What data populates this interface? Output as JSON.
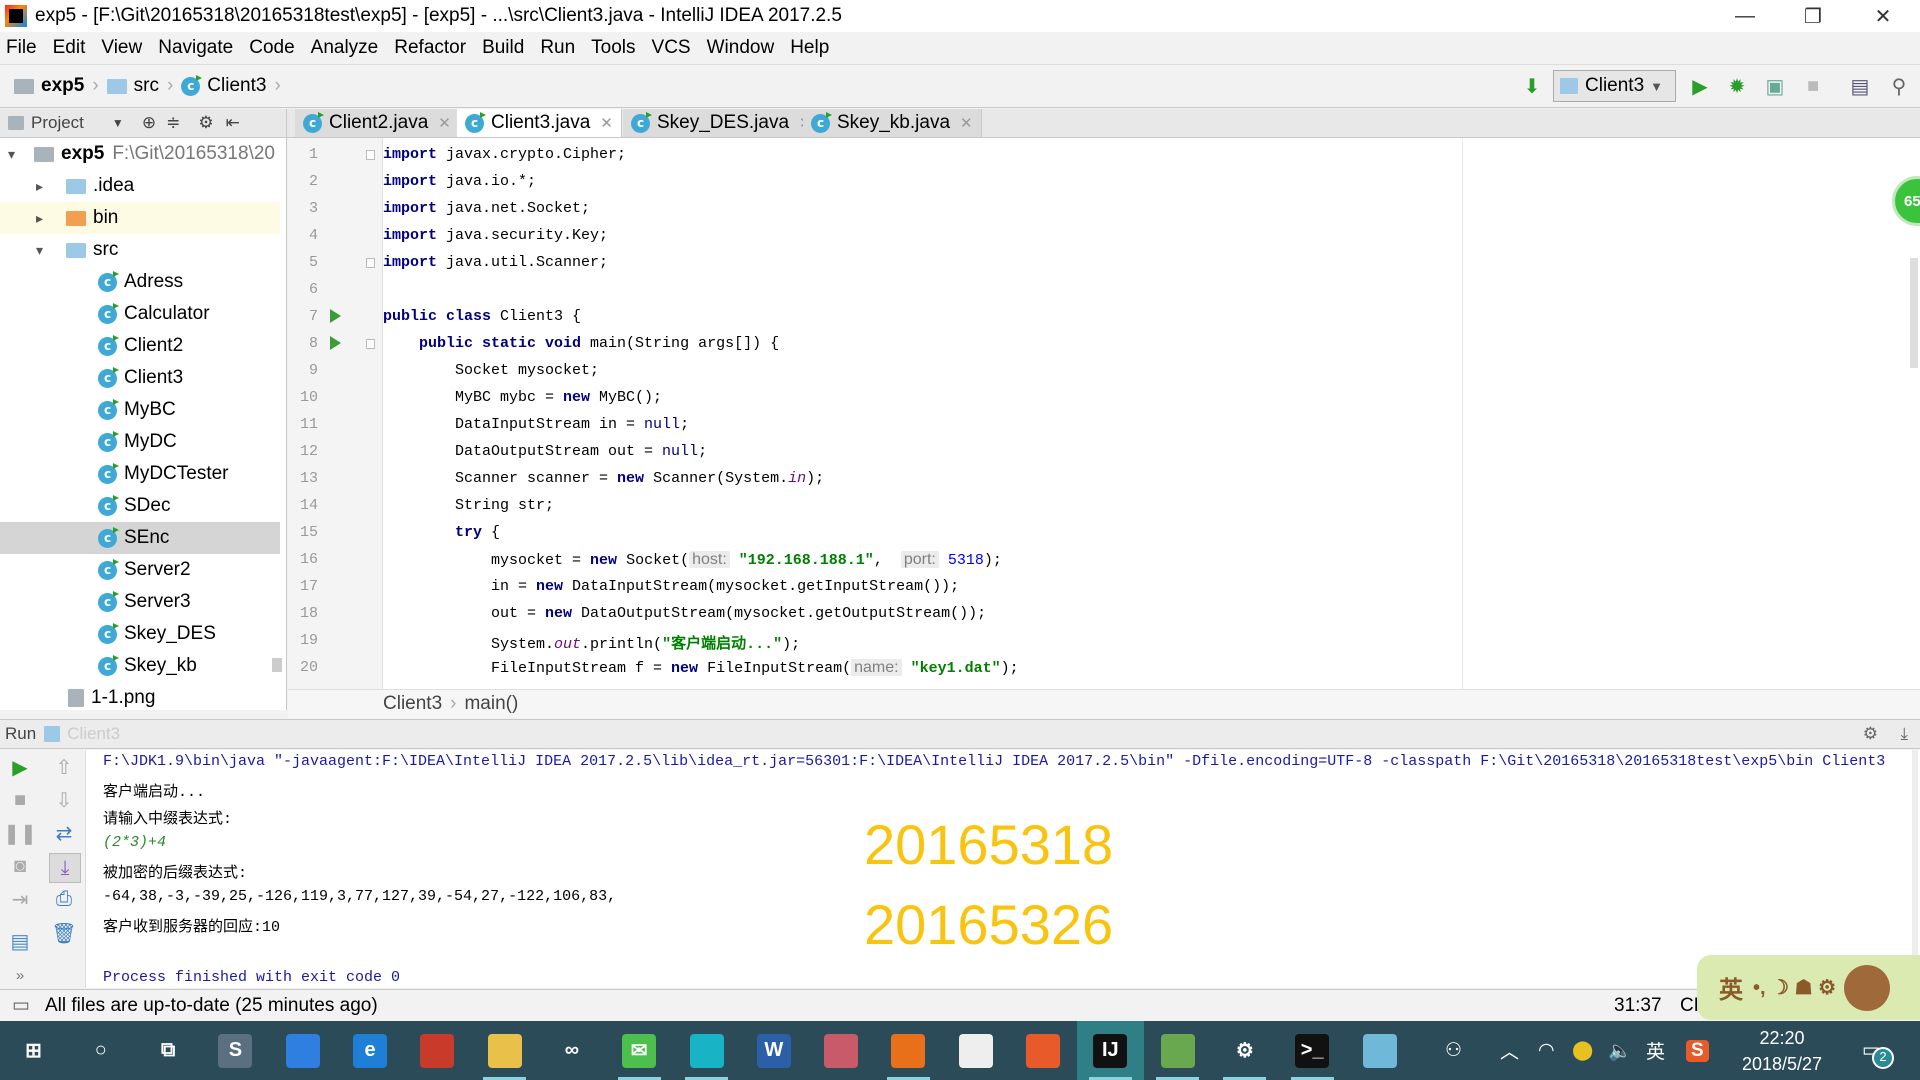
{
  "window": {
    "title": "exp5 - [F:\\Git\\20165318\\20165318test\\exp5] - [exp5] - ...\\src\\Client3.java - IntelliJ IDEA 2017.2.5",
    "minimize": "—",
    "restore": "❐",
    "close": "✕"
  },
  "menu": [
    "File",
    "Edit",
    "View",
    "Navigate",
    "Code",
    "Analyze",
    "Refactor",
    "Build",
    "Run",
    "Tools",
    "VCS",
    "Window",
    "Help"
  ],
  "nav": {
    "crumbs": [
      "exp5",
      "src",
      "Client3"
    ],
    "run_config": "Client3"
  },
  "project_header": "Project",
  "tabs": [
    {
      "label": "Client2.java"
    },
    {
      "label": "Client3.java",
      "active": true
    },
    {
      "label": "Skey_DES.java"
    },
    {
      "label": "Skey_kb.java"
    }
  ],
  "tree": {
    "root": {
      "name": "exp5",
      "path": "F:\\Git\\20165318\\20"
    },
    "items": [
      {
        "label": ".idea",
        "type": "folder"
      },
      {
        "label": "bin",
        "type": "folder-excluded"
      },
      {
        "label": "src",
        "type": "folder"
      },
      {
        "label": "Adress",
        "type": "class"
      },
      {
        "label": "Calculator",
        "type": "class"
      },
      {
        "label": "Client2",
        "type": "class"
      },
      {
        "label": "Client3",
        "type": "class"
      },
      {
        "label": "MyBC",
        "type": "class"
      },
      {
        "label": "MyDC",
        "type": "class"
      },
      {
        "label": "MyDCTester",
        "type": "class"
      },
      {
        "label": "SDec",
        "type": "class"
      },
      {
        "label": "SEnc",
        "type": "class",
        "selected": true
      },
      {
        "label": "Server2",
        "type": "class"
      },
      {
        "label": "Server3",
        "type": "class"
      },
      {
        "label": "Skey_DES",
        "type": "class"
      },
      {
        "label": "Skey_kb",
        "type": "class"
      },
      {
        "label": "1-1.png",
        "type": "image"
      }
    ]
  },
  "code": [
    [
      [
        "import",
        "kw"
      ],
      [
        " javax.crypto.Cipher;",
        ""
      ]
    ],
    [
      [
        "import",
        "kw"
      ],
      [
        " java.io.*;",
        ""
      ]
    ],
    [
      [
        "import",
        "kw"
      ],
      [
        " java.net.Socket;",
        ""
      ]
    ],
    [
      [
        "import",
        "kw"
      ],
      [
        " java.security.Key;",
        ""
      ]
    ],
    [
      [
        "import",
        "kw"
      ],
      [
        " java.util.Scanner;",
        ""
      ]
    ],
    [],
    [
      [
        "public class",
        "kw"
      ],
      [
        " Client3 {",
        ""
      ]
    ],
    [
      [
        "    ",
        ""
      ],
      [
        "public static void",
        "kw"
      ],
      [
        " main(String args[]) {",
        ""
      ]
    ],
    [
      [
        "        Socket mysocket;",
        ""
      ]
    ],
    [
      [
        "        MyBC mybc = ",
        ""
      ],
      [
        "new",
        "kw"
      ],
      [
        " MyBC();",
        ""
      ]
    ],
    [
      [
        "        DataInputStream in = ",
        ""
      ],
      [
        "null",
        "nul"
      ],
      [
        ";",
        ""
      ]
    ],
    [
      [
        "        DataOutputStream out = ",
        ""
      ],
      [
        "null",
        "nul"
      ],
      [
        ";",
        ""
      ]
    ],
    [
      [
        "        Scanner scanner = ",
        ""
      ],
      [
        "new",
        "kw"
      ],
      [
        " Scanner(System.",
        ""
      ],
      [
        "in",
        "it"
      ],
      [
        ");",
        ""
      ]
    ],
    [
      [
        "        String str;",
        ""
      ]
    ],
    [
      [
        "        ",
        ""
      ],
      [
        "try",
        "kw"
      ],
      [
        " {",
        ""
      ]
    ],
    [
      [
        "            mysocket = ",
        ""
      ],
      [
        "new",
        "kw"
      ],
      [
        " Socket(",
        ""
      ],
      [
        "host:",
        "hint"
      ],
      [
        " ",
        ""
      ],
      [
        "\"192.168.188.1\"",
        "str"
      ],
      [
        ",  ",
        ""
      ],
      [
        "port:",
        "hint"
      ],
      [
        " ",
        ""
      ],
      [
        "5318",
        "num"
      ],
      [
        ");",
        ""
      ]
    ],
    [
      [
        "            in = ",
        ""
      ],
      [
        "new",
        "kw"
      ],
      [
        " DataInputStream(mysocket.getInputStream());",
        ""
      ]
    ],
    [
      [
        "            out = ",
        ""
      ],
      [
        "new",
        "kw"
      ],
      [
        " DataOutputStream(mysocket.getOutputStream());",
        ""
      ]
    ],
    [
      [
        "            System.",
        ""
      ],
      [
        "out",
        "it"
      ],
      [
        ".println(",
        ""
      ],
      [
        "\"客户端启动...\"",
        "str"
      ],
      [
        ");",
        ""
      ]
    ],
    [
      [
        "            FileInputStream f = ",
        ""
      ],
      [
        "new",
        "kw"
      ],
      [
        " FileInputStream(",
        ""
      ],
      [
        "name:",
        "hint"
      ],
      [
        " ",
        ""
      ],
      [
        "\"key1.dat\"",
        "str"
      ],
      [
        ");",
        ""
      ]
    ]
  ],
  "breadcrumb": [
    "Client3",
    "main()"
  ],
  "run": {
    "label": "Run",
    "config": "Client3",
    "output": [
      {
        "text": "F:\\JDK1.9\\bin\\java \"-javaagent:F:\\IDEA\\IntelliJ IDEA 2017.2.5\\lib\\idea_rt.jar=56301:F:\\IDEA\\IntelliJ IDEA 2017.2.5\\bin\" -Dfile.encoding=UTF-8 -classpath F:\\Git\\20165318\\20165318test\\exp5\\bin Client3",
        "kind": "cmd"
      },
      {
        "text": "客户端启动...",
        "kind": "out"
      },
      {
        "text": "请输入中缀表达式:",
        "kind": "out"
      },
      {
        "text": "(2*3)+4",
        "kind": "in"
      },
      {
        "text": "被加密的后缀表达式:",
        "kind": "out"
      },
      {
        "text": "-64,38,-3,-39,25,-126,119,3,77,127,39,-54,27,-122,106,83,",
        "kind": "out"
      },
      {
        "text": "客户收到服务器的回应:10",
        "kind": "out"
      },
      {
        "text": "",
        "kind": "out"
      },
      {
        "text": "Process finished with exit code 0",
        "kind": "cmd"
      }
    ],
    "overlay": [
      "20165318",
      "20165326"
    ]
  },
  "status": {
    "message": "All files are up-to-date (25 minutes ago)",
    "position": "31:37",
    "encoding": "CR"
  },
  "ime_widget": "英",
  "inspection_badge": "65",
  "taskbar": {
    "apps": [
      "start",
      "cortana",
      "task-view",
      "app-s",
      "feishu",
      "edge",
      "office",
      "explorer",
      "baidu-netdisk",
      "wechat",
      "qq",
      "word",
      "snipping",
      "firefox",
      "mail",
      "ubuntu",
      "intellij",
      "git",
      "settings",
      "terminal",
      "notepad"
    ],
    "tray": {
      "ime": "英",
      "time": "22:20",
      "date": "2018/5/27",
      "notifications": "2"
    }
  },
  "colors": {
    "yellow_overlay": "#f8c40f",
    "keyword": "#000080",
    "string": "#008000",
    "cmd_output": "#1a1aa6",
    "input_echo": "#2a8a2a",
    "taskbar": "#2b4b58"
  }
}
